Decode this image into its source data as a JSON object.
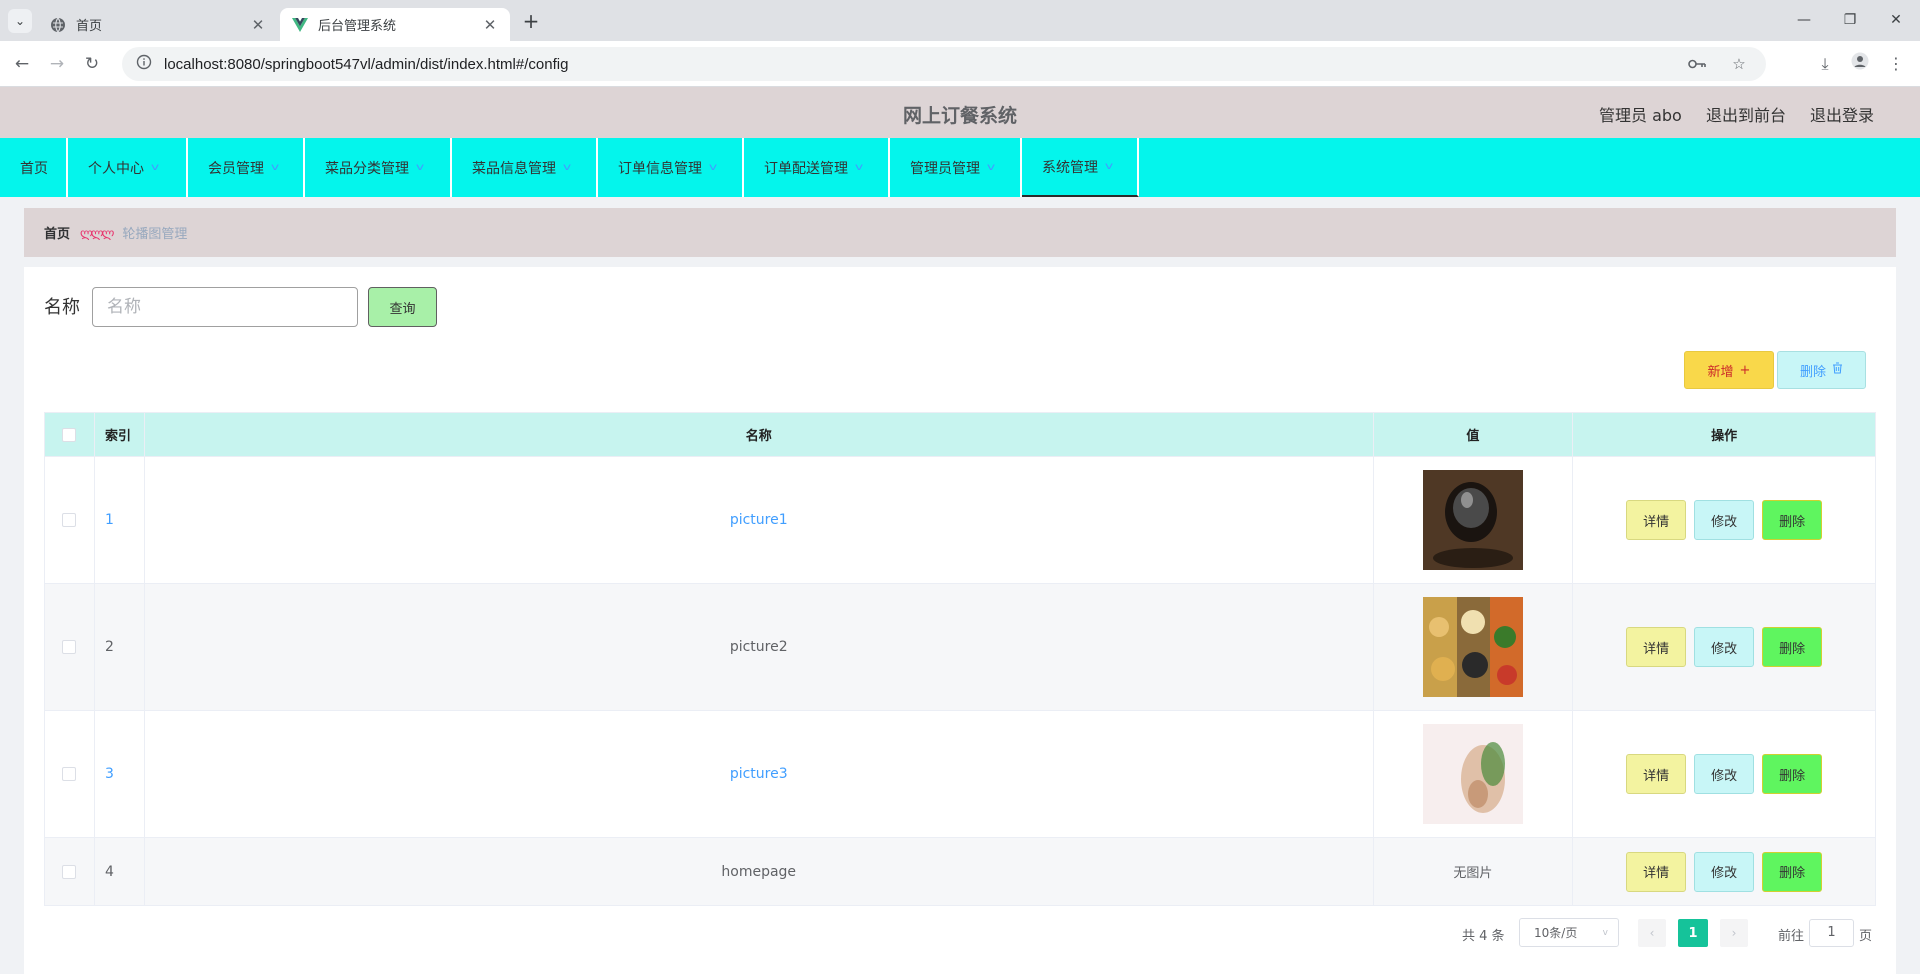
{
  "browser": {
    "tabs": [
      {
        "title": "首页",
        "active": false
      },
      {
        "title": "后台管理系统",
        "active": true
      }
    ],
    "url": "localhost:8080/springboot547vl/admin/dist/index.html#/config"
  },
  "header": {
    "title": "网上订餐系统",
    "user_label": "管理员 abo",
    "to_front": "退出到前台",
    "logout": "退出登录"
  },
  "menu": {
    "items": [
      {
        "label": "首页",
        "dropdown": false
      },
      {
        "label": "个人中心",
        "dropdown": true
      },
      {
        "label": "会员管理",
        "dropdown": true
      },
      {
        "label": "菜品分类管理",
        "dropdown": true
      },
      {
        "label": "菜品信息管理",
        "dropdown": true
      },
      {
        "label": "订单信息管理",
        "dropdown": true
      },
      {
        "label": "订单配送管理",
        "dropdown": true
      },
      {
        "label": "管理员管理",
        "dropdown": true
      },
      {
        "label": "系统管理",
        "dropdown": true,
        "active": true
      }
    ]
  },
  "breadcrumb": {
    "home": "首页",
    "separator": "ლლლ",
    "current": "轮播图管理"
  },
  "search": {
    "label": "名称",
    "placeholder": "名称",
    "value": "",
    "button": "查询"
  },
  "actions": {
    "add": "新增",
    "delete": "删除"
  },
  "table": {
    "columns": [
      "索引",
      "名称",
      "值",
      "操作"
    ],
    "rows": [
      {
        "index": "1",
        "name": "picture1",
        "value_image": "food-photo-1",
        "highlight": true
      },
      {
        "index": "2",
        "name": "picture2",
        "value_image": "food-photo-2",
        "highlight": false
      },
      {
        "index": "3",
        "name": "picture3",
        "value_image": "food-photo-3",
        "highlight": true
      },
      {
        "index": "4",
        "name": "homepage",
        "value_text": "无图片",
        "highlight": false
      }
    ],
    "row_actions": {
      "detail": "详情",
      "edit": "修改",
      "delete": "删除"
    }
  },
  "pagination": {
    "total": "共 4 条",
    "page_size": "10条/页",
    "current_page": "1",
    "goto_label": "前往",
    "goto_value": "1",
    "goto_unit": "页"
  },
  "colors": {
    "header_bg": "#ddd4d5",
    "menu_bg": "#04f5ec",
    "table_head_bg": "#c7f4ef",
    "link": "#409eff",
    "page_active": "#15c39a"
  }
}
